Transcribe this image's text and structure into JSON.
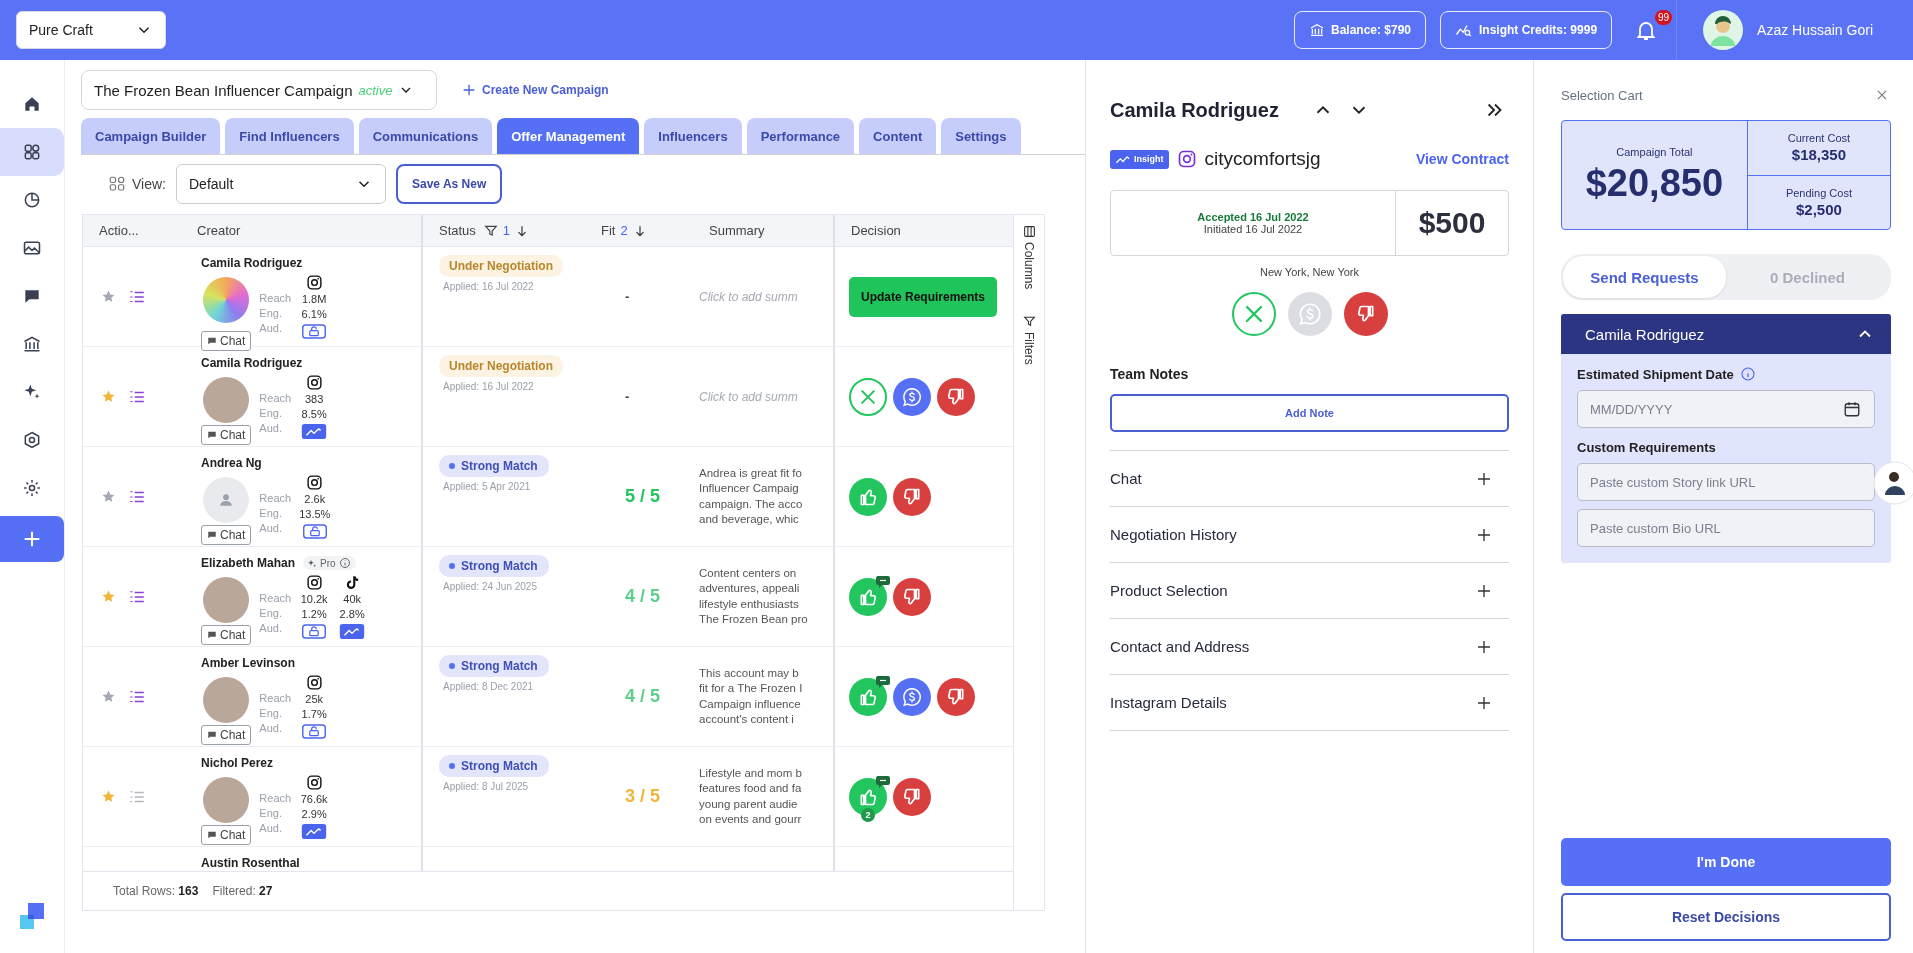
{
  "header": {
    "workspace": "Pure Craft",
    "balance": "Balance: $790",
    "credits": "Insight Credits: 9999",
    "notifications": "99",
    "user": "Azaz Hussain Gori"
  },
  "sidebar": {
    "items": [
      {
        "selected": false
      },
      {
        "selected": true
      },
      {
        "selected": false
      },
      {
        "selected": false
      },
      {
        "selected": false
      },
      {
        "selected": false
      },
      {
        "selected": false
      },
      {
        "selected": false
      },
      {
        "selected": false
      }
    ]
  },
  "campaign": {
    "name": "The Frozen Bean Influencer Campaign",
    "status": "active",
    "create": "Create New Campaign"
  },
  "tabs": [
    {
      "label": "Campaign Builder",
      "selected": false
    },
    {
      "label": "Find Influencers",
      "selected": false
    },
    {
      "label": "Communications",
      "selected": false
    },
    {
      "label": "Offer Management",
      "selected": true
    },
    {
      "label": "Influencers",
      "selected": false
    },
    {
      "label": "Performance",
      "selected": false
    },
    {
      "label": "Content",
      "selected": false
    },
    {
      "label": "Settings",
      "selected": false
    }
  ],
  "view": {
    "label": "View:",
    "value": "Default",
    "save": "Save As New"
  },
  "table": {
    "columns": [
      {
        "label": "Actio..."
      },
      {
        "label": "Creator"
      },
      {
        "label": "Status",
        "filter": true,
        "sort": "1"
      },
      {
        "label": "Fit",
        "filter": false,
        "sort": "2"
      },
      {
        "label": "Summary"
      },
      {
        "label": "Decision"
      }
    ],
    "side_tabs": [
      "Columns",
      "Filters"
    ],
    "rows": [
      {
        "starred": false,
        "notes": true,
        "name": "Camila Rodriguez",
        "avatar": {
          "kind": "logo"
        },
        "chat": "Chat",
        "labels": [
          "Reach",
          "Eng.",
          "Aud."
        ],
        "platforms": [
          {
            "kind": "instagram",
            "reach": "1.8M",
            "eng": "6.1%",
            "audience_locked": true
          }
        ],
        "status": {
          "kind": "negotiation",
          "label": "Under Negotiation"
        },
        "applied": "Applied: 16 Jul 2022",
        "fit": {
          "label": "-",
          "kind": "none"
        },
        "summary": {
          "kind": "placeholder",
          "lines": [
            "Click to add summ"
          ]
        },
        "decision": {
          "kind": "button",
          "label": "Update Requirements"
        }
      },
      {
        "starred": true,
        "notes": true,
        "name": "Camila Rodriguez",
        "avatar": {
          "kind": "photo"
        },
        "chat": "Chat",
        "labels": [
          "Reach",
          "Eng.",
          "Aud."
        ],
        "platforms": [
          {
            "kind": "instagram",
            "reach": "383",
            "eng": "8.5%",
            "audience_locked": false
          }
        ],
        "status": {
          "kind": "negotiation",
          "label": "Under Negotiation"
        },
        "applied": "Applied: 16 Jul 2022",
        "fit": {
          "label": "-",
          "kind": "none"
        },
        "summary": {
          "kind": "placeholder",
          "lines": [
            "Click to add summ"
          ]
        },
        "decision": {
          "kind": "actions",
          "actions": [
            {
              "kind": "cancel",
              "comment": false
            },
            {
              "kind": "negotiate",
              "comment": false
            },
            {
              "kind": "reject",
              "comment": false
            }
          ]
        }
      },
      {
        "starred": false,
        "notes": true,
        "name": "Andrea Ng",
        "avatar": {
          "kind": "placeholder"
        },
        "chat": "Chat",
        "labels": [
          "Reach",
          "Eng.",
          "Aud."
        ],
        "platforms": [
          {
            "kind": "instagram",
            "reach": "2.6k",
            "eng": "13.5%",
            "audience_locked": true
          }
        ],
        "status": {
          "kind": "match",
          "label": "Strong Match"
        },
        "applied": "Applied: 5 Apr 2021",
        "fit": {
          "label": "5 / 5",
          "kind": "high"
        },
        "summary": {
          "kind": "text",
          "lines": [
            "Andrea is great fit fo",
            "Influencer Campaig",
            "campaign. The acco",
            "and beverage, whic"
          ]
        },
        "decision": {
          "kind": "actions",
          "actions": [
            {
              "kind": "accept",
              "comment": false
            },
            {
              "kind": "reject",
              "comment": false
            }
          ]
        }
      },
      {
        "starred": true,
        "notes": true,
        "name": "Elizabeth Mahan",
        "pro": "Pro",
        "avatar": {
          "kind": "photo"
        },
        "chat": "Chat",
        "labels": [
          "Reach",
          "Eng.",
          "Aud."
        ],
        "platforms": [
          {
            "kind": "instagram",
            "reach": "10.2k",
            "eng": "1.2%",
            "audience_locked": true
          },
          {
            "kind": "tiktok",
            "reach": "40k",
            "eng": "2.8%",
            "audience_locked": false
          }
        ],
        "status": {
          "kind": "match",
          "label": "Strong Match"
        },
        "applied": "Applied: 24 Jun 2025",
        "fit": {
          "label": "4 / 5",
          "kind": "mid"
        },
        "summary": {
          "kind": "text",
          "lines": [
            "Content centers on",
            "adventures, appeali",
            "lifestyle enthusiasts",
            "The Frozen Bean pro"
          ]
        },
        "decision": {
          "kind": "actions",
          "actions": [
            {
              "kind": "accept",
              "comment": true
            },
            {
              "kind": "reject",
              "comment": false
            }
          ]
        }
      },
      {
        "starred": false,
        "notes": true,
        "name": "Amber Levinson",
        "avatar": {
          "kind": "photo"
        },
        "chat": "Chat",
        "labels": [
          "Reach",
          "Eng.",
          "Aud."
        ],
        "platforms": [
          {
            "kind": "instagram",
            "reach": "25k",
            "eng": "1.7%",
            "audience_locked": true
          }
        ],
        "status": {
          "kind": "match",
          "label": "Strong Match"
        },
        "applied": "Applied: 8 Dec 2021",
        "fit": {
          "label": "4 / 5",
          "kind": "mid"
        },
        "summary": {
          "kind": "text",
          "lines": [
            "This account may b",
            "fit for a The Frozen I",
            "Campaign influence",
            "account's content i"
          ]
        },
        "decision": {
          "kind": "actions",
          "actions": [
            {
              "kind": "accept",
              "comment": true
            },
            {
              "kind": "negotiate",
              "comment": false
            },
            {
              "kind": "reject",
              "comment": false
            }
          ]
        }
      },
      {
        "starred": true,
        "notes": false,
        "name": "Nichol Perez",
        "avatar": {
          "kind": "photo"
        },
        "chat": "Chat",
        "labels": [
          "Reach",
          "Eng.",
          "Aud."
        ],
        "platforms": [
          {
            "kind": "instagram",
            "reach": "76.6k",
            "eng": "2.9%",
            "audience_locked": false
          }
        ],
        "status": {
          "kind": "match",
          "label": "Strong Match"
        },
        "applied": "Applied: 8 Jul 2025",
        "fit": {
          "label": "3 / 5",
          "kind": "low"
        },
        "summary": {
          "kind": "text",
          "lines": [
            "Lifestyle and mom b",
            "features food and fa",
            "young parent audie",
            "on events and gourr"
          ]
        },
        "decision": {
          "kind": "actions",
          "actions": [
            {
              "kind": "accept",
              "comment": true,
              "count": "2"
            },
            {
              "kind": "reject",
              "comment": false
            }
          ]
        }
      }
    ],
    "partial_row": {
      "name": "Austin Rosenthal"
    },
    "total": "Total Rows: **163**",
    "filtered": "Filtered: **27**"
  },
  "detail": {
    "name": "Camila Rodriguez",
    "insight": "Insight",
    "handle": "citycomfortsjg",
    "contract": "View Contract",
    "accepted": "Accepted 16 Jul 2022",
    "initiated": "Initiated 16 Jul 2022",
    "price": "$500",
    "location": "New York, New York",
    "actions": [
      {
        "kind": "cancel",
        "disabled": false
      },
      {
        "kind": "negotiate",
        "disabled": true
      },
      {
        "kind": "reject",
        "disabled": false
      }
    ],
    "notes_title": "Team Notes",
    "add_note": "Add Note",
    "sections": [
      {
        "label": "Chat",
        "expanded": false
      },
      {
        "label": "Negotiation History",
        "expanded": false
      },
      {
        "label": "Product Selection",
        "expanded": false
      },
      {
        "label": "Contact and Address",
        "expanded": false
      },
      {
        "label": "Instagram Details",
        "expanded": false
      }
    ]
  },
  "cart": {
    "title": "Selection Cart",
    "total_label": "Campaign Total",
    "total": "$20,850",
    "current_label": "Current Cost",
    "current": "$18,350",
    "pending_label": "Pending Cost",
    "pending": "$2,500",
    "segments": [
      {
        "label": "Send Requests",
        "selected": true
      },
      {
        "label": "0 Declined",
        "selected": false
      }
    ],
    "card": {
      "name": "Camila Rodriguez",
      "expanded": true,
      "date_label": "Estimated Shipment Date",
      "date_placeholder": "MM/DD/YYYY",
      "req_label": "Custom Requirements",
      "fields": [
        {
          "placeholder": "Paste custom Story link URL"
        },
        {
          "placeholder": "Paste custom Bio URL"
        }
      ]
    },
    "done": "I'm Done",
    "reset": "Reset Decisions"
  }
}
